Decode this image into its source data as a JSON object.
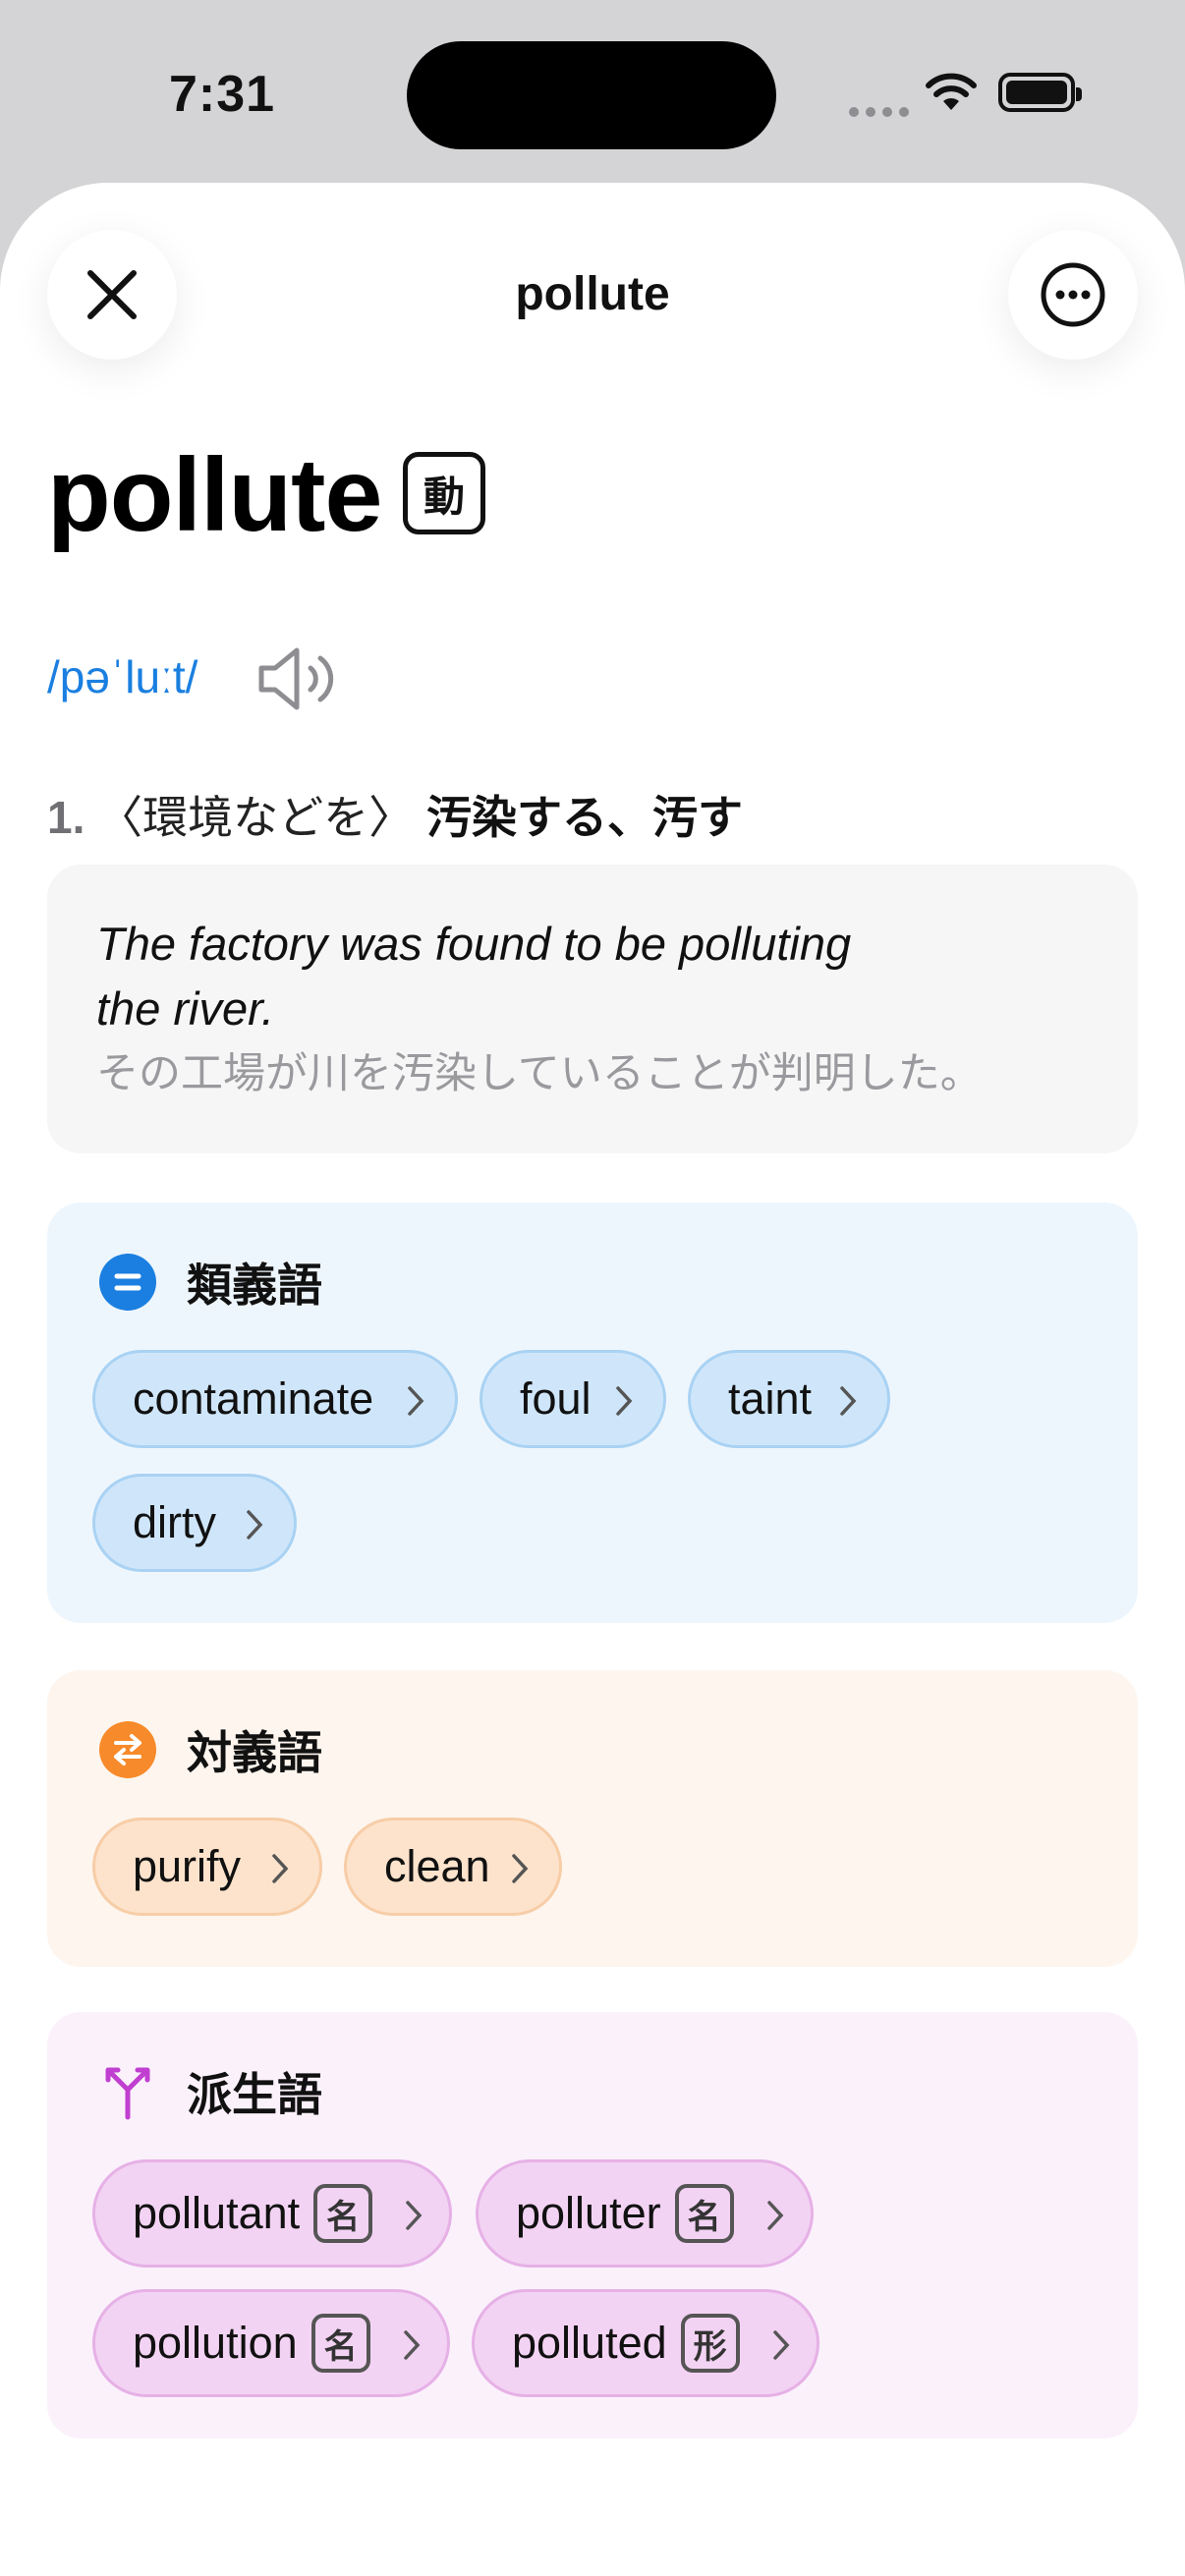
{
  "status_bar": {
    "time": "7:31"
  },
  "nav": {
    "title": "pollute",
    "close_icon": "close-icon",
    "more_icon": "more-options-icon"
  },
  "entry": {
    "word": "pollute",
    "pos": "動",
    "pronunciation": "/pəˈluːt/",
    "definition": {
      "number": "1.",
      "context": "〈環境などを〉",
      "meaning": "汚染する、汚す"
    },
    "example": {
      "en_line1": "The factory was found to be polluting",
      "en_line2": "the river.",
      "ja": "その工場が川を汚染していることが判明した。"
    }
  },
  "synonyms": {
    "title": "類義語",
    "color": "#1a7fe0",
    "items": [
      "contaminate",
      "foul",
      "taint",
      "dirty"
    ]
  },
  "antonyms": {
    "title": "対義語",
    "color": "#f78a2a",
    "items": [
      "purify",
      "clean"
    ]
  },
  "derivatives": {
    "title": "派生語",
    "color": "#c03fd0",
    "items": [
      {
        "word": "pollutant",
        "pos": "名"
      },
      {
        "word": "polluter",
        "pos": "名"
      },
      {
        "word": "pollution",
        "pos": "名"
      },
      {
        "word": "polluted",
        "pos": "形"
      }
    ]
  }
}
